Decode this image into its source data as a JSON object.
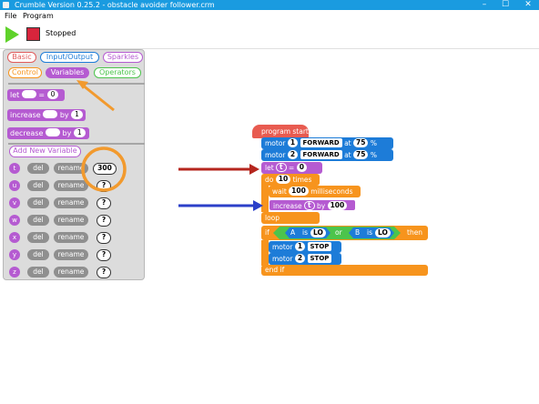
{
  "window": {
    "title": "Crumble Version 0.25.2 - obstacle avoider follower.crm",
    "minimize": "–",
    "maximize": "☐",
    "close": "✕"
  },
  "menu": {
    "file": "File",
    "program": "Program"
  },
  "toolbar": {
    "status": "Stopped"
  },
  "palette": {
    "tabs": [
      "Basic",
      "Input/Output",
      "Sparkles",
      "Control",
      "Variables",
      "Operators"
    ],
    "active_tab": "Variables",
    "blocks": {
      "let_label": "let",
      "let_value": "0",
      "increase_label": "increase",
      "increase_by": "by",
      "increase_value": "1",
      "decrease_label": "decrease",
      "decrease_by": "by",
      "decrease_value": "1"
    },
    "add_new_variable": "Add New Variable",
    "del_label": "del",
    "rename_label": "rename",
    "variables": [
      {
        "name": "t",
        "value": "300"
      },
      {
        "name": "u",
        "value": "?"
      },
      {
        "name": "v",
        "value": "?"
      },
      {
        "name": "w",
        "value": "?"
      },
      {
        "name": "x",
        "value": "?"
      },
      {
        "name": "y",
        "value": "?"
      },
      {
        "name": "z",
        "value": "?"
      }
    ]
  },
  "script": {
    "program_start": "program start",
    "motor_label": "motor",
    "at_label": "at",
    "percent": "%",
    "motor1": {
      "num": "1",
      "dir": "FORWARD",
      "speed": "75"
    },
    "motor2": {
      "num": "2",
      "dir": "FORWARD",
      "speed": "75"
    },
    "let_label": "let",
    "let_var": "t",
    "let_value": "0",
    "do_label": "do",
    "do_times": "10",
    "times_label": "times",
    "wait_label": "wait",
    "wait_value": "100",
    "ms_label": "milliseconds",
    "inc_label": "increase",
    "inc_var": "t",
    "inc_by": "by",
    "inc_value": "100",
    "loop_label": "loop",
    "if_label": "if",
    "cond_a": "A",
    "is_label": "is",
    "cond_a_val": "LO",
    "or_label": "or",
    "cond_b": "B",
    "cond_b_val": "LO",
    "then_label": "then",
    "stop1": {
      "num": "1",
      "action": "STOP"
    },
    "stop2": {
      "num": "2",
      "action": "STOP"
    },
    "end_if": "end if"
  },
  "colors": {
    "arrow_orange": "#f29a2e",
    "arrow_red": "#b5261e",
    "arrow_blue": "#2b3fc9"
  }
}
